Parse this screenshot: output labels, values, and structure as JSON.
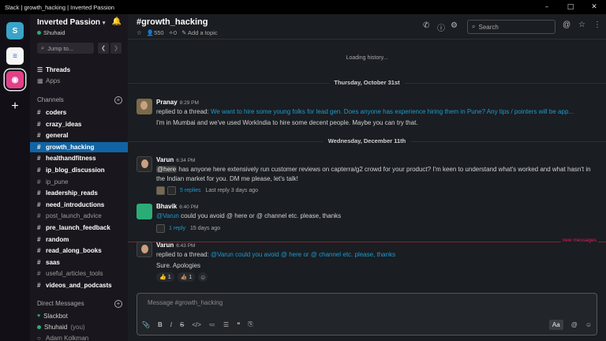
{
  "window": {
    "title": "Slack | growth_hacking | Inverted Passion",
    "controls": [
      "–",
      "□",
      "✕"
    ]
  },
  "workspaces": [
    {
      "name": "Inverted Passion",
      "glyph": "S"
    },
    {
      "name": "workspace-2",
      "glyph": "≡"
    },
    {
      "name": "workspace-3",
      "glyph": "◉"
    },
    {
      "name": "add-workspace",
      "glyph": "+"
    }
  ],
  "sidebar": {
    "team_name": "Inverted Passion",
    "user_name": "Shuhaid",
    "jump_placeholder": "Jump to...",
    "top_items": [
      {
        "label": "Threads",
        "icon": "threads-icon",
        "glyph": "☰"
      },
      {
        "label": "Apps",
        "icon": "apps-icon",
        "glyph": "▦"
      }
    ],
    "channels_header": "Channels",
    "channels": [
      {
        "name": "coders",
        "style": "bold"
      },
      {
        "name": "crazy_ideas",
        "style": "bold"
      },
      {
        "name": "general",
        "style": "bold"
      },
      {
        "name": "growth_hacking",
        "style": "active"
      },
      {
        "name": "healthandfitness",
        "style": "bold"
      },
      {
        "name": "ip_blog_discussion",
        "style": "bold"
      },
      {
        "name": "ip_pune",
        "style": "dim"
      },
      {
        "name": "leadership_reads",
        "style": "bold"
      },
      {
        "name": "need_introductions",
        "style": "bold"
      },
      {
        "name": "post_launch_advice",
        "style": "dim"
      },
      {
        "name": "pre_launch_feedback",
        "style": "bold"
      },
      {
        "name": "random",
        "style": "bold"
      },
      {
        "name": "read_along_books",
        "style": "bold"
      },
      {
        "name": "saas",
        "style": "bold"
      },
      {
        "name": "useful_articles_tools",
        "style": "dim"
      },
      {
        "name": "videos_and_podcasts",
        "style": "bold"
      }
    ],
    "dm_header": "Direct Messages",
    "dms": [
      {
        "name": "Slackbot",
        "suffix": ""
      },
      {
        "name": "Shuhaid",
        "suffix": "(you)"
      },
      {
        "name": "Adam Kolkman",
        "suffix": ""
      }
    ]
  },
  "channel": {
    "name": "#growth_hacking",
    "members": "550",
    "pinned": "0",
    "add_topic": "Add a topic",
    "search_placeholder": "Search"
  },
  "history": {
    "loading": "Loading history...",
    "date1": "Thursday, October 31st",
    "date2": "Wednesday, December 11th",
    "new_messages": "new messages"
  },
  "messages": {
    "pranay": {
      "user": "Pranay",
      "time": "8:29 PM",
      "replied_prefix": "replied to a thread:",
      "replied_link": "We want to hire some young folks for lead gen. Does anyone has experience hiring them in Pune? Any tips / pointers will be app...",
      "text": "I'm in Mumbai and we've used WorkIndia to hire some decent people. Maybe you can try that."
    },
    "varun1": {
      "user": "Varun",
      "time": "6:34 PM",
      "mention": "@here",
      "text": "has anyone here extensively run customer reviews on capterra/g2 crowd for your product? I'm keen to understand what's worked and what hasn't in the Indian market for you. DM me please, let's talk!",
      "replies": "5 replies",
      "last_reply": "Last reply 3 days ago"
    },
    "bhavik": {
      "user": "Bhavik",
      "time": "6:40 PM",
      "mention": "@Varun",
      "text": "could you avoid @ here or @ channel etc. please, thanks",
      "replies": "1 reply",
      "last_reply": "15 days ago"
    },
    "varun2": {
      "user": "Varun",
      "time": "6:43 PM",
      "replied_prefix": "replied to a thread:",
      "replied_link": "@Varun could you avoid @ here or @ channel etc. please, thanks",
      "text": "Sure. Apologies",
      "reactions": [
        {
          "emoji": "👍",
          "count": "1"
        },
        {
          "emoji": "👍🏽",
          "count": "1"
        }
      ]
    }
  },
  "composer": {
    "placeholder": "Message #growth_hacking",
    "format_aa": "Aa"
  }
}
